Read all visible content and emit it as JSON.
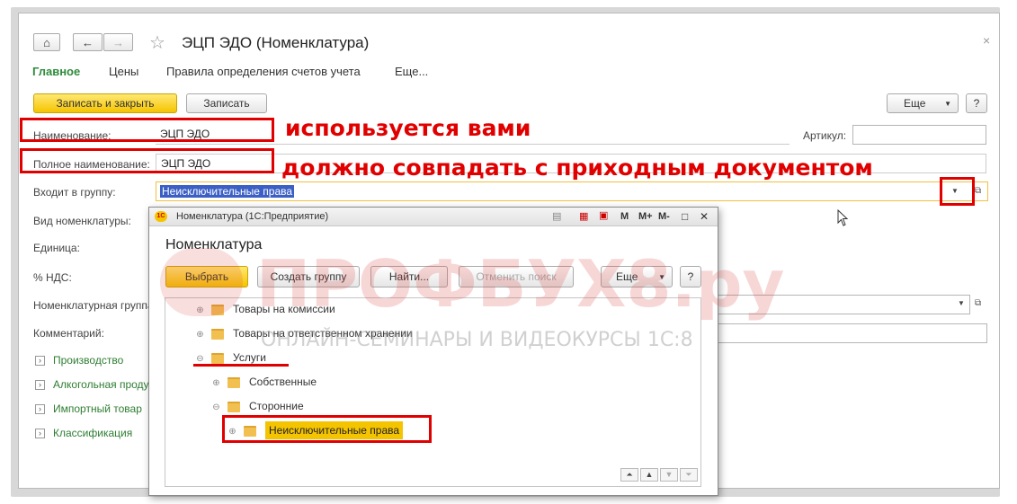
{
  "window": {
    "title": "ЭЦП ЭДО (Номенклатура)",
    "close": "×",
    "home_icon": "⌂",
    "back_icon": "←",
    "forward_icon": "→",
    "star_icon": "☆"
  },
  "tabs": [
    "Главное",
    "Цены",
    "Правила определения счетов учета",
    "Еще..."
  ],
  "toolbar": {
    "save_close": "Записать и закрыть",
    "save": "Записать",
    "more": "Еще",
    "help": "?"
  },
  "form": {
    "name_label": "Наименование:",
    "name_value": "ЭЦП ЭДО",
    "article_label": "Артикул:",
    "article_value": "",
    "fullname_label": "Полное наименование:",
    "fullname_value": "ЭЦП ЭДО",
    "group_label": "Входит в группу:",
    "group_value": "Неисключительные права",
    "kind_label": "Вид номенклатуры:",
    "unit_label": "Единица:",
    "vat_label": "% НДС:",
    "nomgroup_label": "Номенклатурная группа",
    "comment_label": "Комментарий:"
  },
  "sections": [
    "Производство",
    "Алкогольная проду",
    "Импортный товар",
    "Классификация"
  ],
  "annotations": {
    "used": "используется вами",
    "match": "должно совпадать с приходным документом"
  },
  "popup": {
    "titlebar": "Номенклатура  (1С:Предприятие)",
    "logo": "1С",
    "title_buttons": [
      "M",
      "M+",
      "M-",
      "□",
      "✕"
    ],
    "heading": "Номенклатура",
    "select": "Выбрать",
    "create_group": "Создать группу",
    "find": "Найти...",
    "cancel_search": "Отменить поиск",
    "more": "Еще",
    "help": "?",
    "tree": [
      {
        "label": "Товары на комиссии",
        "toggle": "⊕"
      },
      {
        "label": "Товары на ответственном хранении",
        "toggle": "⊕"
      },
      {
        "label": "Услуги",
        "toggle": "⊖"
      },
      {
        "label": "Собственные",
        "toggle": "⊕"
      },
      {
        "label": "Сторонние",
        "toggle": "⊖"
      },
      {
        "label": "Неисключительные права",
        "toggle": "⊕"
      }
    ],
    "scroll": [
      "⏶",
      "▲",
      "▼",
      "⏷"
    ]
  },
  "watermark": {
    "brand": "ПРОФБУХ8.ру",
    "subtitle": "ОНЛАЙН-СЕМИНАРЫ И ВИДЕОКУРСЫ 1С:8"
  },
  "colors": {
    "accent_green": "#2e8b3a",
    "primary_yellow": "#f5c400",
    "annotation_red": "#e10000",
    "selection_blue": "#3b5fc4"
  }
}
